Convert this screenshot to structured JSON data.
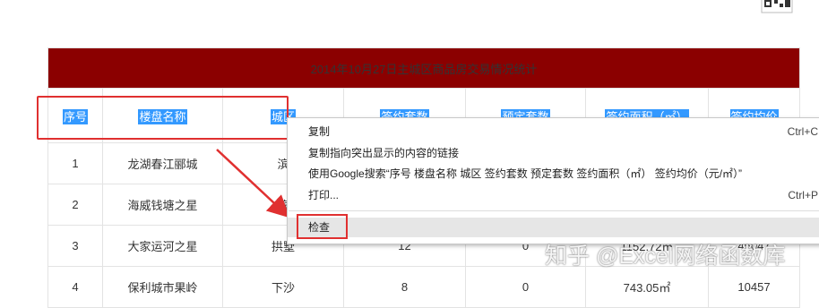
{
  "table": {
    "title": "2014年10月27日主城区商品房交易情况统计",
    "headers": [
      "序号",
      "楼盘名称",
      "城区",
      "签约套数",
      "预定套数",
      "签约面积（㎡）",
      "签约均价"
    ],
    "rows": [
      [
        "1",
        "龙湖春江郦城",
        "滨",
        "",
        "",
        "",
        ""
      ],
      [
        "2",
        "海威钱塘之星",
        "滨",
        "",
        "",
        "",
        ""
      ],
      [
        "3",
        "大家运河之星",
        "拱墅",
        "12",
        "0",
        "1152.72㎡",
        "45047"
      ],
      [
        "4",
        "保利城市果岭",
        "下沙",
        "8",
        "0",
        "743.05㎡",
        "10457"
      ]
    ]
  },
  "context_menu": {
    "items": [
      {
        "label": "复制",
        "shortcut": "Ctrl+C"
      },
      {
        "label": "复制指向突出显示的内容的链接",
        "shortcut": ""
      },
      {
        "label": "使用Google搜索“序号 楼盘名称 城区 签约套数 预定套数 签约面积（㎡） 签约均价（元/㎡）”",
        "shortcut": ""
      },
      {
        "label": "打印...",
        "shortcut": "Ctrl+P"
      },
      {
        "label": "检查",
        "shortcut": ""
      }
    ]
  },
  "watermark": "知乎 @Excel网络函数库",
  "colors": {
    "title_bg": "#8b0000",
    "selection": "#3399ff",
    "annotation": "#e03030"
  },
  "icons": [
    "qr-code-icon",
    "arrow-annotation"
  ]
}
